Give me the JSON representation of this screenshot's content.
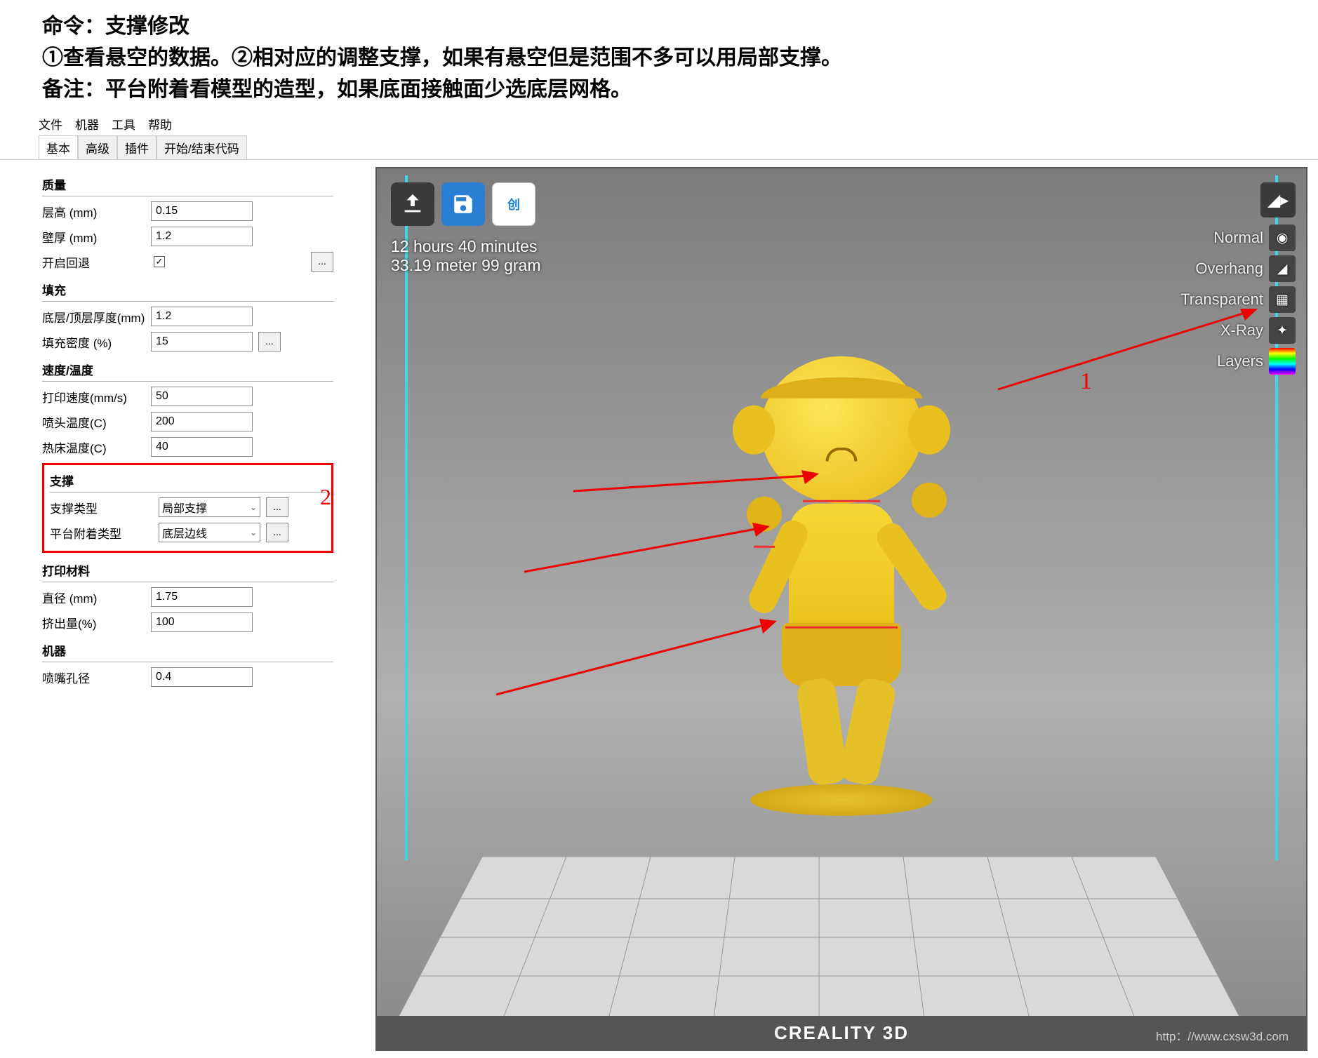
{
  "header": {
    "line1": "命令：支撑修改",
    "line2": "①查看悬空的数据。②相对应的调整支撑，如果有悬空但是范围不多可以用局部支撑。",
    "line3": "备注：平台附着看模型的造型，如果底面接触面少选底层网格。"
  },
  "menubar": [
    "文件",
    "机器",
    "工具",
    "帮助"
  ],
  "tabs": [
    "基本",
    "高级",
    "插件",
    "开始/结束代码"
  ],
  "sections": {
    "quality": {
      "title": "质量",
      "layer_height": {
        "label": "层高 (mm)",
        "value": "0.15"
      },
      "wall": {
        "label": "壁厚 (mm)",
        "value": "1.2"
      },
      "retract": {
        "label": "开启回退",
        "checked": true
      }
    },
    "fill": {
      "title": "填充",
      "top_bottom": {
        "label": "底层/顶层厚度(mm)",
        "value": "1.2"
      },
      "density": {
        "label": "填充密度 (%)",
        "value": "15"
      }
    },
    "speed": {
      "title": "速度/温度",
      "print_speed": {
        "label": "打印速度(mm/s)",
        "value": "50"
      },
      "nozzle_temp": {
        "label": "喷头温度(C)",
        "value": "200"
      },
      "bed_temp": {
        "label": "热床温度(C)",
        "value": "40"
      }
    },
    "support": {
      "title": "支撑",
      "type": {
        "label": "支撑类型",
        "value": "局部支撑"
      },
      "platform": {
        "label": "平台附着类型",
        "value": "底层边线"
      }
    },
    "material": {
      "title": "打印材料",
      "diameter": {
        "label": "直径 (mm)",
        "value": "1.75"
      },
      "flow": {
        "label": "挤出量(%)",
        "value": "100"
      }
    },
    "machine": {
      "title": "机器",
      "nozzle": {
        "label": "喷嘴孔径",
        "value": "0.4"
      }
    }
  },
  "viewport": {
    "print_time": "12 hours 40 minutes",
    "print_stats": "33.19 meter 99 gram",
    "view_modes": [
      "Normal",
      "Overhang",
      "Transparent",
      "X-Ray",
      "Layers"
    ],
    "footer_brand": "CREALITY 3D",
    "watermark": "http：//www.cxsw3d.com"
  },
  "markers": {
    "m1": "1",
    "m2": "2"
  }
}
